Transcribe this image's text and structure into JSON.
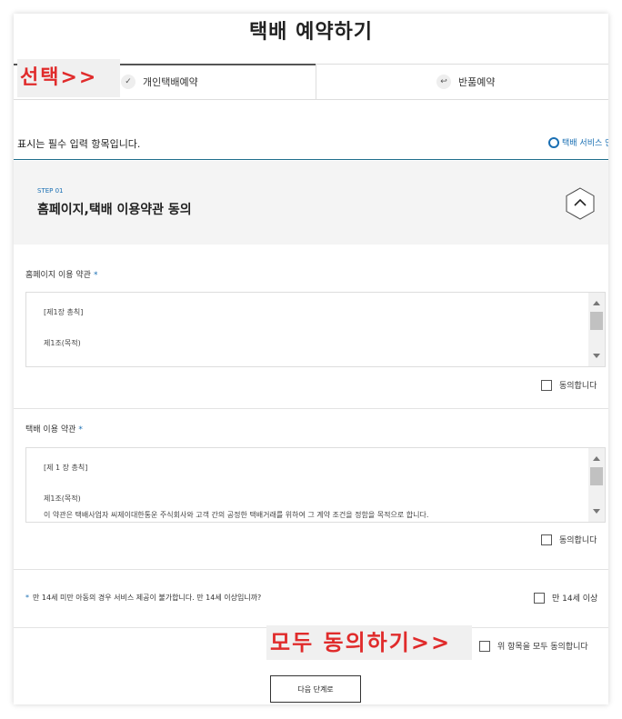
{
  "title": "택배 예약하기",
  "annotations": {
    "select": "선택>>",
    "agree_all": "모두 동의하기>>"
  },
  "tabs": [
    {
      "label": "개인택배예약",
      "icon": "check-icon",
      "active": true
    },
    {
      "label": "반품예약",
      "icon": "return-icon",
      "active": false
    }
  ],
  "required_note": "표시는 필수 입력 항목입니다.",
  "service_link": "택배 서비스 안",
  "step": {
    "label": "STEP 01",
    "title": "홈페이지,택배 이용약관 동의"
  },
  "homepage_terms": {
    "label": "홈페이지 이용 약관",
    "required_mark": "*",
    "lines": [
      "[제1장 총칙]",
      "제1조(목적)"
    ],
    "agree": "동의합니다"
  },
  "delivery_terms": {
    "label": "택배 이용 약관",
    "required_mark": "*",
    "lines": [
      "[제 1 장 총칙]",
      "제1조(목적)",
      "이 약관은 택배사업자 씨제이대한통운 주식회사와 고객 간의 공정한 택배거래를 위하여 그 계약 조건을 정함을 목적으로 합니다."
    ],
    "agree": "동의합니다"
  },
  "age": {
    "required_mark": "*",
    "text": "만 14세 미만 아동의 경우 서비스 제공이 불가합니다. 만 14세 이상입니까?",
    "checkbox": "만 14세 이상"
  },
  "agree_all": "위 항목을 모두 동의합니다",
  "next_button": "다음 단계로",
  "colors": {
    "accent": "#1a6fb3",
    "annotation": "#e02b2b"
  }
}
